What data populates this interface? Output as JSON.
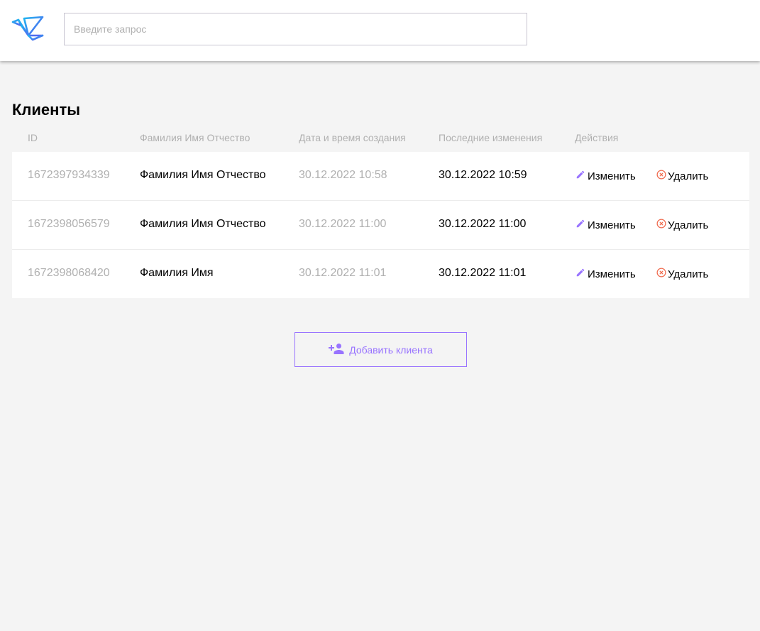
{
  "header": {
    "logo_icon": "origami-bird-logo",
    "search_placeholder": "Введите запрос"
  },
  "page_title": "Клиенты",
  "table": {
    "columns": [
      "ID",
      "Фамилия Имя Отчество",
      "Дата и время создания",
      "Последние изменения",
      "Действия"
    ],
    "rows": [
      {
        "id": "1672397934339",
        "name": "Фамилия Имя Отчество",
        "created": "30.12.2022 10:58",
        "updated": "30.12.2022 10:59"
      },
      {
        "id": "1672398056579",
        "name": "Фамилия Имя Отчество",
        "created": "30.12.2022 11:00",
        "updated": "30.12.2022 11:00"
      },
      {
        "id": "1672398068420",
        "name": "Фамилия Имя",
        "created": "30.12.2022 11:01",
        "updated": "30.12.2022 11:01"
      }
    ],
    "edit_label": "Изменить",
    "delete_label": "Удалить",
    "edit_icon": "pencil-icon",
    "delete_icon": "circle-x-icon"
  },
  "add_button": {
    "label": "Добавить клиента",
    "icon": "add-user-icon"
  },
  "colors": {
    "accent": "#9873ff",
    "delete": "#f06a4d",
    "muted": "#b0b0b0",
    "background": "#f4f4f4"
  }
}
